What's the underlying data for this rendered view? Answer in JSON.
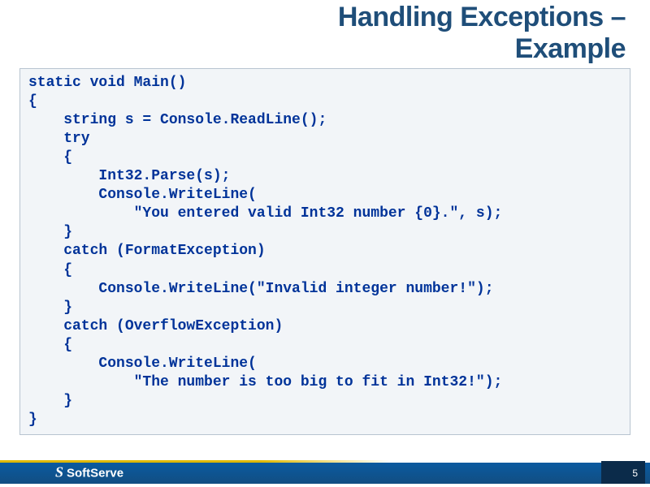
{
  "title_line1": "Handling Exceptions –",
  "title_line2": "Example",
  "code": "static void Main()\n{\n    string s = Console.ReadLine();\n    try\n    {\n        Int32.Parse(s);\n        Console.WriteLine(\n            \"You entered valid Int32 number {0}.\", s);\n    }\n    catch (FormatException)\n    {\n        Console.WriteLine(\"Invalid integer number!\");\n    }\n    catch (OverflowException)\n    {\n        Console.WriteLine(\n            \"The number is too big to fit in Int32!\");\n    }\n}",
  "footer": {
    "logo_s": "S",
    "logo_text": "SoftServe",
    "page_number": "5"
  }
}
